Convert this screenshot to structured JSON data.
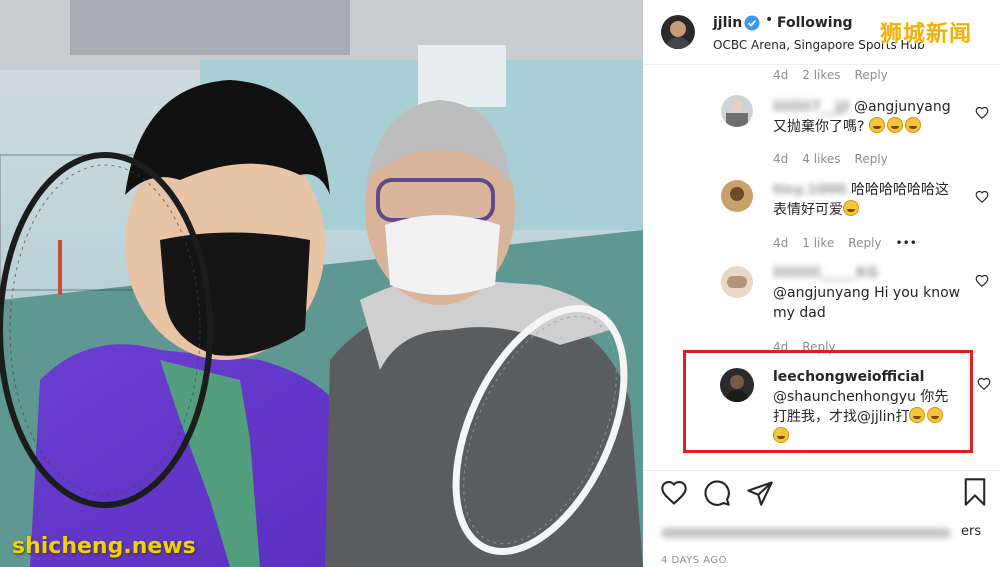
{
  "post": {
    "username": "jjlin",
    "follow_status": "Following",
    "location": "OCBC Arena, Singapore Sports Hub"
  },
  "comments": [
    {
      "meta": {
        "time": "4d",
        "likes": "2 likes",
        "reply": "Reply"
      }
    },
    {
      "username": "lililili7__jjl",
      "mention": "@angjunyang",
      "text": "又抛棄你了嗎?",
      "meta": {
        "time": "4d",
        "likes": "4 likes",
        "reply": "Reply"
      }
    },
    {
      "username": "tiny.1000",
      "text_line1": "哈哈哈哈哈哈这",
      "text_line2": "表情好可爱",
      "meta": {
        "time": "4d",
        "likes": "1 like",
        "reply": "Reply",
        "more": "•••"
      }
    },
    {
      "username": "lilililili_____KG",
      "mention": "@angjunyang",
      "text": "Hi you know my dad",
      "meta": {
        "time": "4d",
        "reply": "Reply"
      }
    },
    {
      "username": "leechongweiofficial",
      "mention": "@shaunchenhongyu",
      "text_a": "你先",
      "text_b": "打胜我，才找",
      "mention2": "@jjlin",
      "text_c": "打"
    }
  ],
  "liked_by": "ers",
  "date": "4 DAYS AGO",
  "watermarks": {
    "top_right": "狮城新闻",
    "bottom_left": "shicheng.news"
  },
  "colors": {
    "highlight": "#e02020",
    "verified": "#3897f0",
    "text": "#262626",
    "muted": "#8e8e8e"
  },
  "icons": [
    "heart-icon",
    "comment-icon",
    "share-icon",
    "bookmark-icon",
    "verified-badge-icon"
  ]
}
